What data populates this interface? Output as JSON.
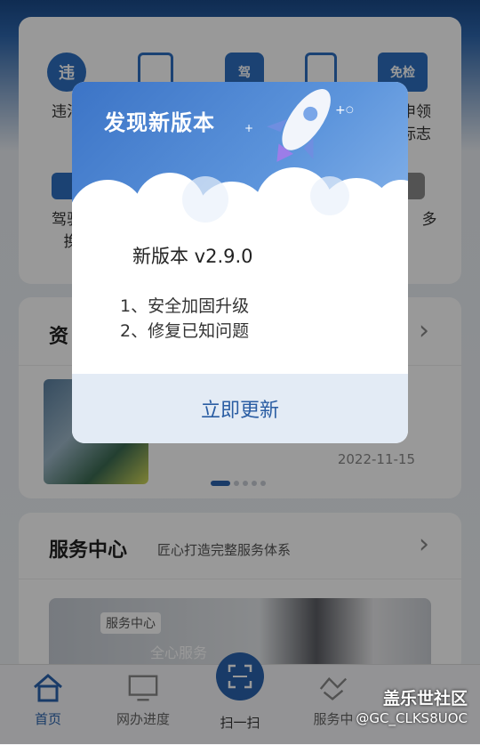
{
  "grid": {
    "items": [
      {
        "label": "违法",
        "icon_text": "违"
      },
      {
        "label": "",
        "icon_text": ""
      },
      {
        "label": "",
        "icon_text": "驾"
      },
      {
        "label": "",
        "icon_text": ""
      },
      {
        "label": "申领",
        "label2": "标志",
        "icon_text": "免检"
      }
    ],
    "row2": [
      {
        "label": "驾驶",
        "label2": "换"
      },
      {
        "label": "多"
      }
    ]
  },
  "news": {
    "title": "资",
    "date": "2022-11-15"
  },
  "service": {
    "title": "服务中心",
    "subtitle": "匠心打造完整服务体系",
    "tag": "服务中心",
    "caption": "全心服务"
  },
  "tabs": [
    {
      "label": "首页"
    },
    {
      "label": "网办进度"
    },
    {
      "label": "扫一扫"
    },
    {
      "label": "服务中"
    }
  ],
  "modal": {
    "title": "发现新版本",
    "version": "新版本  v2.9.0",
    "notes": [
      "1、安全加固升级",
      "2、修复已知问题"
    ],
    "button": "立即更新"
  },
  "watermark": {
    "line1": "盖乐世社区",
    "line2": "@GC_CLKS8UOC"
  },
  "colors": {
    "accent": "#2a63ad",
    "header": "#1a4a89"
  }
}
